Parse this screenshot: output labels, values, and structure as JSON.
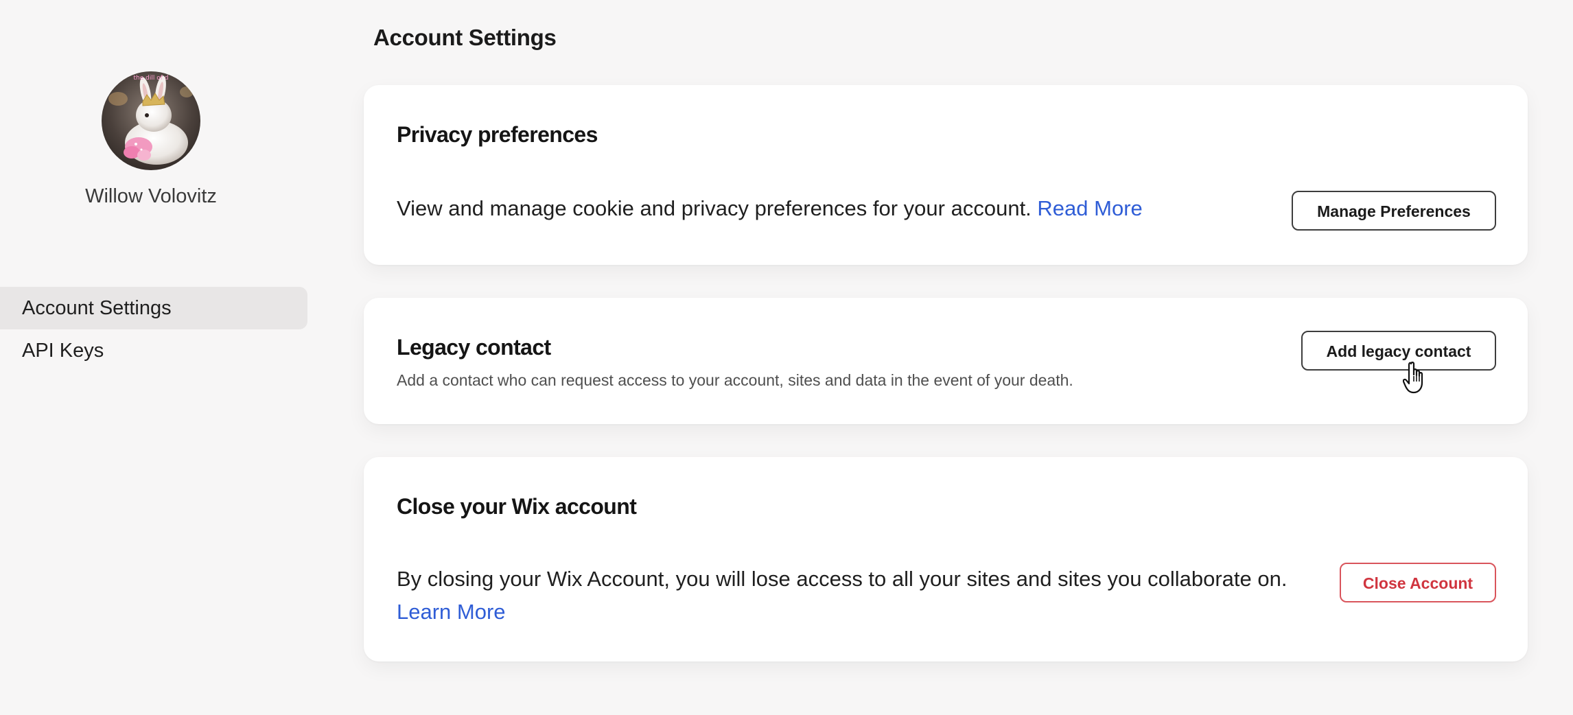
{
  "profile": {
    "name": "Willow Volovitz",
    "avatar_overlay_text": "the dill of d"
  },
  "sidebar": {
    "items": [
      {
        "label": "Account Settings",
        "active": true
      },
      {
        "label": "API Keys",
        "active": false
      }
    ]
  },
  "header": {
    "title": "Account Settings"
  },
  "privacy": {
    "title": "Privacy preferences",
    "description": "View and manage cookie and privacy preferences for your account.",
    "link": "Read More",
    "button": "Manage Preferences"
  },
  "legacy": {
    "title": "Legacy contact",
    "description": "Add a contact who can request access to your account, sites and data in the event of your death.",
    "button": "Add legacy contact"
  },
  "close_account": {
    "title": "Close your Wix account",
    "description": "By closing your Wix Account, you will lose access to all your sites and sites you collaborate on.",
    "link": "Learn More",
    "button": "Close Account"
  },
  "colors": {
    "background": "#f7f6f6",
    "link": "#2f5dd6",
    "danger": "#d0353f",
    "active_nav": "#e8e6e6"
  },
  "icons": {
    "cursor": "hand-pointer-icon"
  }
}
